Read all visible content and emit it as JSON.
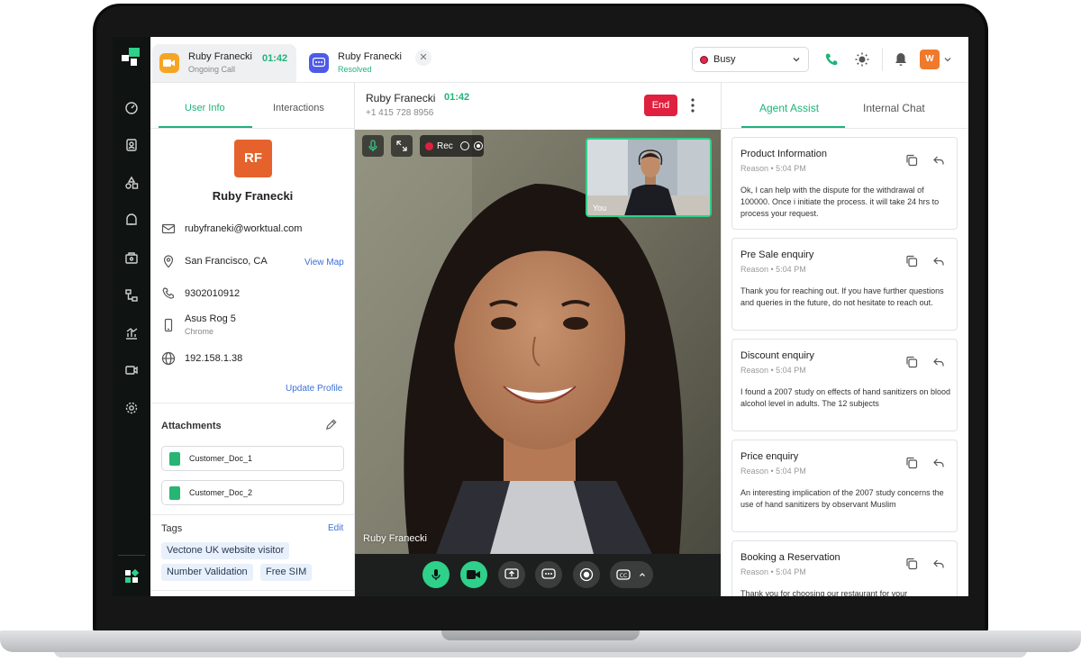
{
  "app": {
    "active_call": {
      "name": "Ruby Franecki",
      "status": "Ongoing Call",
      "time": "01:42"
    },
    "second_call": {
      "name": "Ruby Franecki",
      "status": "Resolved"
    },
    "agent_status": "Busy",
    "avatar_initial": "W"
  },
  "user_panel": {
    "tabs": [
      "User Info",
      "Interactions"
    ],
    "initials": "RF",
    "name": "Ruby Franecki",
    "email": "rubyfraneki@worktual.com",
    "location": "San Francisco, CA",
    "view_map": "View Map",
    "phone": "9302010912",
    "device": "Asus Rog 5",
    "browser": "Chrome",
    "ip": "192.158.1.38",
    "update_profile": "Update Profile",
    "attachments_title": "Attachments",
    "attachments": [
      "Customer_Doc_1",
      "Customer_Doc_2"
    ],
    "tags_title": "Tags",
    "tags_edit": "Edit",
    "tags": [
      "Vectone UK website visitor",
      "Number Validation",
      "Free SIM"
    ]
  },
  "video": {
    "caller_name": "Ruby Franecki",
    "call_time": "01:42",
    "caller_phone": "+1 415 728 8956",
    "end_label": "End",
    "rec_label": "Rec",
    "video_label": "Ruby Franecki",
    "pip_label": "You"
  },
  "right_panel": {
    "tabs": [
      "Agent Assist",
      "Internal Chat"
    ],
    "cards": [
      {
        "title": "Product Information",
        "reason": "Reason  •  5:04 PM",
        "body": "Ok, I can help with the dispute for the withdrawal of 100000. Once i initiate the process. it will take 24 hrs  to process your request."
      },
      {
        "title": "Pre Sale enquiry",
        "reason": "Reason  •  5:04 PM",
        "body": "Thank you for reaching out. If you have further questions and queries in the future, do not hesitate to reach out."
      },
      {
        "title": "Discount enquiry",
        "reason": "Reason  •  5:04 PM",
        "body": "I found a 2007 study on effects of hand sanitizers on blood alcohol level in adults. The 12 subjects"
      },
      {
        "title": "Price enquiry",
        "reason": "Reason  •  5:04 PM",
        "body": "An interesting implication of the 2007 study concerns the use of hand sanitizers by observant Muslim"
      },
      {
        "title": "Booking a Reservation",
        "reason": "Reason  •  5:04 PM",
        "body": "Thank you for choosing our restaurant for your"
      }
    ]
  },
  "colors": {
    "accent": "#1fb37a",
    "danger": "#e0203f",
    "rail": "#0f1312",
    "brand_orange": "#e5622c"
  }
}
